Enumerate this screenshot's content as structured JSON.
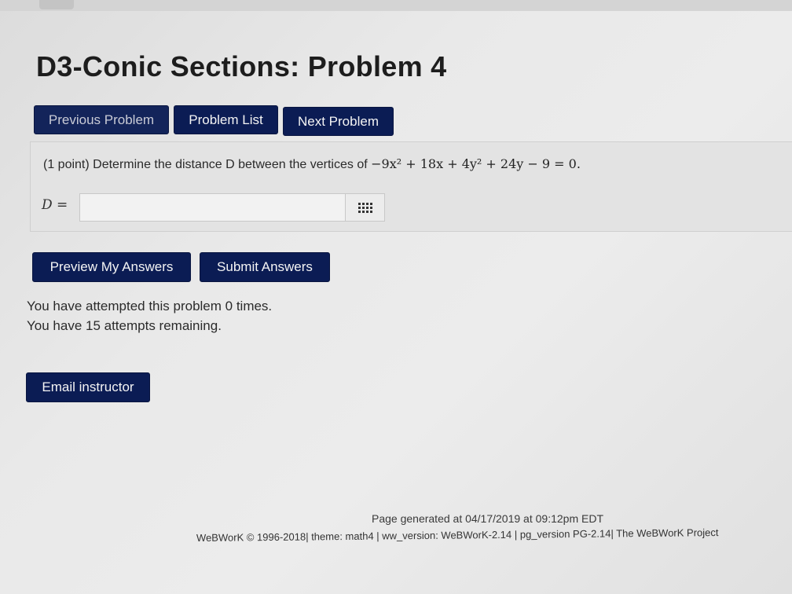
{
  "page": {
    "title": "D3-Conic Sections: Problem 4"
  },
  "nav": {
    "previous_label": "Previous Problem",
    "list_label": "Problem List",
    "next_label": "Next Problem"
  },
  "problem": {
    "points": "(1 point)",
    "prompt": "Determine the distance D between the vertices of",
    "equation": "−9x² + 18x + 4y² + 24y − 9 = 0.",
    "answer_label": "D =",
    "answer_value": "",
    "answer_placeholder": "",
    "editor_icon": "grid-icon"
  },
  "actions": {
    "preview_label": "Preview My Answers",
    "submit_label": "Submit Answers"
  },
  "attempts": {
    "attempted_text": "You have attempted this problem 0 times.",
    "remaining_text": "You have 15 attempts remaining."
  },
  "email": {
    "label": "Email instructor"
  },
  "footer": {
    "generated": "Page generated at 04/17/2019 at 09:12pm EDT",
    "credits": "WeBWorK © 1996-2018| theme: math4 | ww_version: WeBWorK-2.14 | pg_version PG-2.14| The WeBWorK Project"
  },
  "colors": {
    "button_bg": "#0b1c54",
    "button_text": "#f4f4f4",
    "problem_box_bg": "#e3e3e3"
  }
}
